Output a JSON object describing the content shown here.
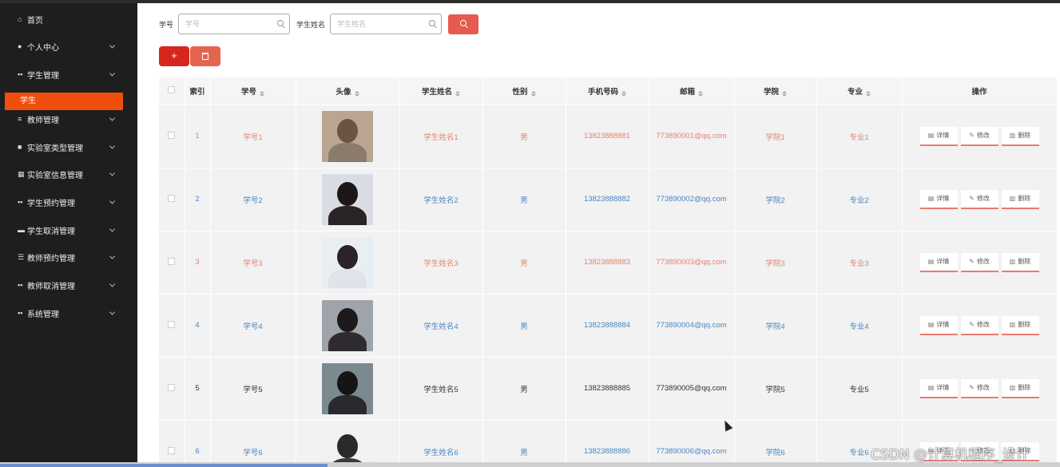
{
  "sidebar": {
    "items": [
      {
        "label": "首页",
        "icon": "home-icon",
        "glyph": "⌂",
        "chevron": false
      },
      {
        "label": "个人中心",
        "icon": "user-icon",
        "glyph": "●",
        "chevron": true
      },
      {
        "label": "学生管理",
        "icon": "grid-icon",
        "glyph": "▪▪",
        "chevron": true
      },
      {
        "label": "教师管理",
        "icon": "list-icon",
        "glyph": "≡",
        "chevron": true
      },
      {
        "label": "实验室类型管理",
        "icon": "box-icon",
        "glyph": "■",
        "chevron": true
      },
      {
        "label": "实验室信息管理",
        "icon": "table-icon",
        "glyph": "▦",
        "chevron": true
      },
      {
        "label": "学生预约管理",
        "icon": "grid-icon",
        "glyph": "▪▪",
        "chevron": true
      },
      {
        "label": "学生取消管理",
        "icon": "image-icon",
        "glyph": "▬",
        "chevron": true
      },
      {
        "label": "教师预约管理",
        "icon": "sliders-icon",
        "glyph": "☰",
        "chevron": true
      },
      {
        "label": "教师取消管理",
        "icon": "grid-icon",
        "glyph": "▪▪",
        "chevron": true
      },
      {
        "label": "系统管理",
        "icon": "grid-icon",
        "glyph": "▪▪",
        "chevron": true
      }
    ],
    "active_sub": "学生"
  },
  "search": {
    "id_label": "学号",
    "id_placeholder": "学号",
    "name_label": "学生姓名",
    "name_placeholder": "学生姓名"
  },
  "toolbar": {
    "add_label": "+"
  },
  "table": {
    "headers": [
      "索引",
      "学号",
      "头像",
      "学生姓名",
      "性别",
      "手机号码",
      "邮箱",
      "学院",
      "专业",
      "操作"
    ],
    "ops": {
      "detail": "详情",
      "edit": "修改",
      "delete": "删除"
    },
    "rows": [
      {
        "index": "1",
        "sid": "学号1",
        "name": "学生姓名1",
        "gender": "男",
        "phone": "13823888881",
        "email": "773890001@qq.com",
        "college": "学院1",
        "major": "专业1",
        "tone": "pink"
      },
      {
        "index": "2",
        "sid": "学号2",
        "name": "学生姓名2",
        "gender": "男",
        "phone": "13823888882",
        "email": "773890002@qq.com",
        "college": "学院2",
        "major": "专业2",
        "tone": "blue"
      },
      {
        "index": "3",
        "sid": "学号3",
        "name": "学生姓名3",
        "gender": "男",
        "phone": "13823888883",
        "email": "773890003@qq.com",
        "college": "学院3",
        "major": "专业3",
        "tone": "pink"
      },
      {
        "index": "4",
        "sid": "学号4",
        "name": "学生姓名4",
        "gender": "男",
        "phone": "13823888884",
        "email": "773890004@qq.com",
        "college": "学院4",
        "major": "专业4",
        "tone": "blue"
      },
      {
        "index": "5",
        "sid": "学号5",
        "name": "学生姓名5",
        "gender": "男",
        "phone": "13823888885",
        "email": "773890005@qq.com",
        "college": "学院5",
        "major": "专业5",
        "tone": "dark"
      },
      {
        "index": "6",
        "sid": "学号6",
        "name": "学生姓名6",
        "gender": "男",
        "phone": "13823888886",
        "email": "773890006@qq.com",
        "college": "学院6",
        "major": "专业6",
        "tone": "blue"
      }
    ]
  },
  "watermark": "CSDN @计算机程序_设计",
  "colors": {
    "accent": "#f04e0c",
    "search_button": "#e65a4f",
    "add_button": "#d9261c",
    "delete_button": "#e4654f",
    "pink_text": "#e5826e",
    "blue_text": "#4a86c4"
  }
}
